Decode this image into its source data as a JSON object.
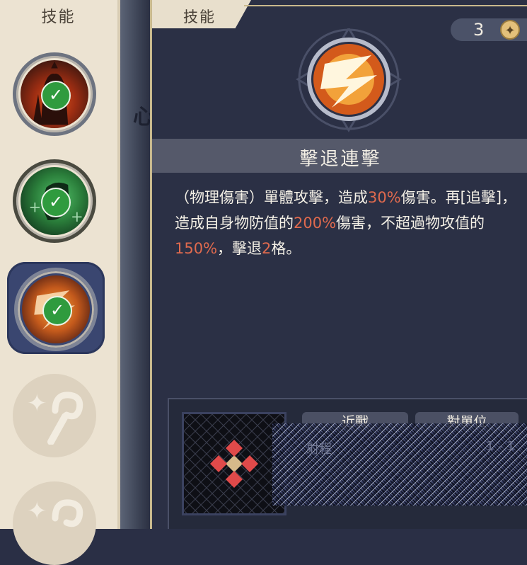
{
  "sidebar": {
    "title": "技能",
    "slots": [
      {
        "name": "skill-slot-fire",
        "unlocked": true,
        "checked": true
      },
      {
        "name": "skill-slot-wind",
        "unlocked": true,
        "checked": true
      },
      {
        "name": "skill-slot-lightning",
        "unlocked": true,
        "checked": true,
        "selected": true
      },
      {
        "name": "skill-slot-locked-1",
        "unlocked": false
      },
      {
        "name": "skill-slot-locked-2",
        "unlocked": false
      }
    ]
  },
  "background_char": "心",
  "detail": {
    "tab_label": "技能",
    "skill_points": "3",
    "skill_name": "擊退連擊",
    "description": [
      {
        "text": "（物理傷害）單體攻擊，造成",
        "hl": false
      },
      {
        "text": "30%",
        "hl": true
      },
      {
        "text": "傷害。再[追擊]，造成自身物防值的",
        "hl": false
      },
      {
        "text": "200%",
        "hl": true
      },
      {
        "text": "傷害，不超過物攻值的",
        "hl": false
      },
      {
        "text": "150%",
        "hl": true
      },
      {
        "text": "，擊退",
        "hl": false
      },
      {
        "text": "2",
        "hl": true
      },
      {
        "text": "格。",
        "hl": false
      }
    ],
    "range": {
      "tag_1": "近戰",
      "tag_2": "對單位",
      "label": "射程",
      "value": "1 - 1"
    }
  },
  "colors": {
    "highlight": "#e06a4e",
    "check_green": "#2f9b3e",
    "panel_bg": "#2b3045",
    "sidebar_bg": "#ece3d2",
    "gold": "#e3c07a"
  }
}
